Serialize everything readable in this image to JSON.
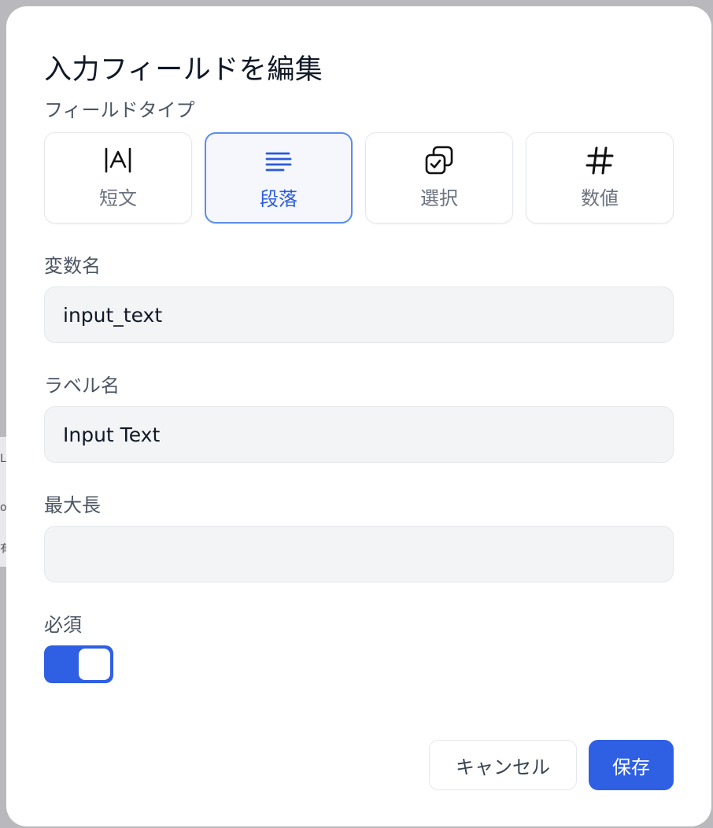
{
  "backdrop": {
    "text_1": "L",
    "text_2": "ot",
    "text_3": "有"
  },
  "modal": {
    "title": "入力フィールドを編集",
    "field_type_label": "フィールドタイプ",
    "types": [
      {
        "label": "短文",
        "icon": "text-cursor-icon",
        "selected": false
      },
      {
        "label": "段落",
        "icon": "paragraph-lines-icon",
        "selected": true
      },
      {
        "label": "選択",
        "icon": "multi-select-icon",
        "selected": false
      },
      {
        "label": "数値",
        "icon": "hash-icon",
        "selected": false
      }
    ],
    "variable_name": {
      "label": "変数名",
      "value": "input_text"
    },
    "label_name": {
      "label": "ラベル名",
      "value": "Input Text"
    },
    "max_length": {
      "label": "最大長",
      "value": ""
    },
    "required": {
      "label": "必須",
      "on": true
    },
    "buttons": {
      "cancel": "キャンセル",
      "save": "保存"
    }
  },
  "colors": {
    "accent": "#2f5fe3",
    "selected_border": "#5b8def",
    "field_bg": "#f3f4f6"
  }
}
